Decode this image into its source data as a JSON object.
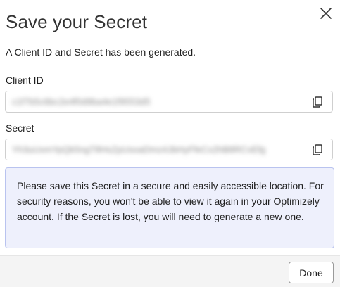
{
  "dialog": {
    "title": "Save your Secret",
    "subtitle": "A Client ID and Secret has been generated."
  },
  "client_id": {
    "label": "Client ID",
    "value": "c1f7b5c6bc2e4f0d9ba4e1f9553d5"
  },
  "secret": {
    "label": "Secret",
    "value": "Yh3uUxmYpQk5ngT8HsZpUsoaDmz4JbHyFfeCx2hB8RCvEfg"
  },
  "notice": {
    "text": "Please save this Secret in a secure and easily accessible location. For security reasons, you won't be able to view it again in your Optimizely account. If the Secret is lost, you will need to generate a new one."
  },
  "footer": {
    "done_label": "Done"
  },
  "icons": {
    "close": "close-icon",
    "copy": "copy-icon"
  }
}
